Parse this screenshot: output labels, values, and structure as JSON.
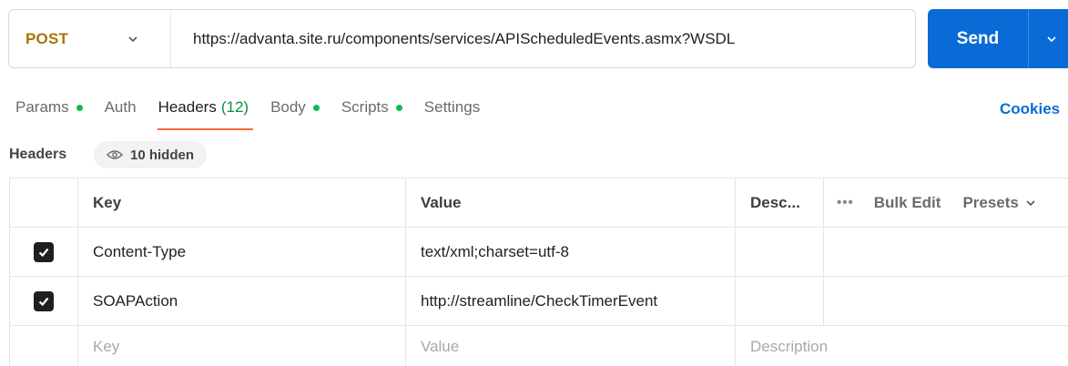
{
  "request": {
    "method": "POST",
    "url": "https://advanta.site.ru/components/services/APIScheduledEvents.asmx?WSDL",
    "send_label": "Send"
  },
  "tabs": [
    {
      "label": "Params",
      "dot": true
    },
    {
      "label": "Auth",
      "dot": false
    },
    {
      "label": "Headers",
      "count": "(12)",
      "active": true
    },
    {
      "label": "Body",
      "dot": true
    },
    {
      "label": "Scripts",
      "dot": true
    },
    {
      "label": "Settings",
      "dot": false
    }
  ],
  "cookies_label": "Cookies",
  "headers_section": {
    "label": "Headers",
    "hidden_label": "10 hidden"
  },
  "table": {
    "columns": {
      "key": "Key",
      "value": "Value",
      "description": "Desc..."
    },
    "actions": {
      "more": "•••",
      "bulk_edit": "Bulk Edit",
      "presets": "Presets"
    },
    "rows": [
      {
        "checked": true,
        "key": "Content-Type",
        "value": "text/xml;charset=utf-8",
        "description": ""
      },
      {
        "checked": true,
        "key": "SOAPAction",
        "value": "http://streamline/CheckTimerEvent",
        "description": ""
      }
    ],
    "placeholders": {
      "key": "Key",
      "value": "Value",
      "description": "Description"
    }
  },
  "colors": {
    "method": "#a8750b",
    "send": "#0b6bd6",
    "active_tab_underline": "#f26b3a",
    "dot": "#0cbb52"
  }
}
